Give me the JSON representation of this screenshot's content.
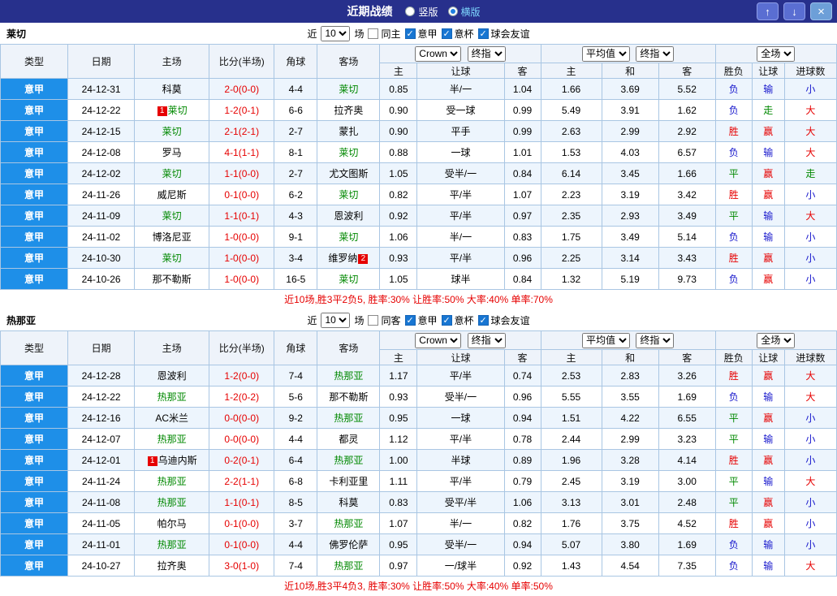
{
  "colors": {
    "navy": "#27308c",
    "accent": "#1e8fe8",
    "focus_green": "#008800",
    "score_red": "#e60000",
    "grid": "#a9c6e3"
  },
  "title_bar": {
    "title": "近期战绩",
    "vertical_label": "竖版",
    "horizontal_label": "横版",
    "up_icon": "↑",
    "down_icon": "↓",
    "close_icon": "×"
  },
  "filter": {
    "near_label": "近",
    "count_value": "10",
    "games_label": "场",
    "leagues": [
      "意甲",
      "意杯",
      "球会友谊"
    ]
  },
  "table_header": {
    "type": "类型",
    "date": "日期",
    "home": "主场",
    "score": "比分(半场)",
    "corner": "角球",
    "away": "客场",
    "handicap_group": {
      "book_select": "Crown",
      "stage_select": "终指",
      "home": "主",
      "line": "让球",
      "away": "客"
    },
    "europe_group": {
      "avg_select": "平均值",
      "stage_select": "终指",
      "home": "主",
      "draw": "和",
      "away": "客"
    },
    "result_group": {
      "scope_select": "全场",
      "wl": "胜负",
      "handicap": "让球",
      "goals": "进球数"
    }
  },
  "result_colors": {
    "胜": "red",
    "赢": "red",
    "大": "red",
    "平": "green",
    "走": "green",
    "负": "blue",
    "输": "blue",
    "小": "blue"
  },
  "sections": [
    {
      "team": "莱切",
      "same_label": "同主",
      "summary": "近10场,胜3平2负5, 胜率:30% 让胜率:50% 大率:40% 单率:70%",
      "rows": [
        {
          "league": "意甲",
          "date": "24-12-31",
          "home": "科莫",
          "score": "2-0(0-0)",
          "corner": "4-4",
          "away": "莱切",
          "away_focus": true,
          "ah_home": "0.85",
          "ah_line": "半/一",
          "ah_away": "1.04",
          "eu_home": "1.66",
          "eu_draw": "3.69",
          "eu_away": "5.52",
          "res_wl": "负",
          "res_ah": "输",
          "res_goal": "小"
        },
        {
          "league": "意甲",
          "date": "24-12-22",
          "home": "莱切",
          "home_badge": "1",
          "home_focus": true,
          "score": "1-2(0-1)",
          "corner": "6-6",
          "away": "拉齐奥",
          "ah_home": "0.90",
          "ah_line": "受一球",
          "ah_away": "0.99",
          "eu_home": "5.49",
          "eu_draw": "3.91",
          "eu_away": "1.62",
          "res_wl": "负",
          "res_ah": "走",
          "res_goal": "大"
        },
        {
          "league": "意甲",
          "date": "24-12-15",
          "home": "莱切",
          "home_focus": true,
          "score": "2-1(2-1)",
          "corner": "2-7",
          "away": "蒙扎",
          "ah_home": "0.90",
          "ah_line": "平手",
          "ah_away": "0.99",
          "eu_home": "2.63",
          "eu_draw": "2.99",
          "eu_away": "2.92",
          "res_wl": "胜",
          "res_ah": "赢",
          "res_goal": "大"
        },
        {
          "league": "意甲",
          "date": "24-12-08",
          "home": "罗马",
          "score": "4-1(1-1)",
          "corner": "8-1",
          "away": "莱切",
          "away_focus": true,
          "ah_home": "0.88",
          "ah_line": "一球",
          "ah_away": "1.01",
          "eu_home": "1.53",
          "eu_draw": "4.03",
          "eu_away": "6.57",
          "res_wl": "负",
          "res_ah": "输",
          "res_goal": "大"
        },
        {
          "league": "意甲",
          "date": "24-12-02",
          "home": "莱切",
          "home_focus": true,
          "score": "1-1(0-0)",
          "corner": "2-7",
          "away": "尤文图斯",
          "ah_home": "1.05",
          "ah_line": "受半/一",
          "ah_away": "0.84",
          "eu_home": "6.14",
          "eu_draw": "3.45",
          "eu_away": "1.66",
          "res_wl": "平",
          "res_ah": "赢",
          "res_goal": "走"
        },
        {
          "league": "意甲",
          "date": "24-11-26",
          "home": "威尼斯",
          "score": "0-1(0-0)",
          "corner": "6-2",
          "away": "莱切",
          "away_focus": true,
          "ah_home": "0.82",
          "ah_line": "平/半",
          "ah_away": "1.07",
          "eu_home": "2.23",
          "eu_draw": "3.19",
          "eu_away": "3.42",
          "res_wl": "胜",
          "res_ah": "赢",
          "res_goal": "小"
        },
        {
          "league": "意甲",
          "date": "24-11-09",
          "home": "莱切",
          "home_focus": true,
          "score": "1-1(0-1)",
          "corner": "4-3",
          "away": "恩波利",
          "ah_home": "0.92",
          "ah_line": "平/半",
          "ah_away": "0.97",
          "eu_home": "2.35",
          "eu_draw": "2.93",
          "eu_away": "3.49",
          "res_wl": "平",
          "res_ah": "输",
          "res_goal": "大"
        },
        {
          "league": "意甲",
          "date": "24-11-02",
          "home": "博洛尼亚",
          "score": "1-0(0-0)",
          "corner": "9-1",
          "away": "莱切",
          "away_focus": true,
          "ah_home": "1.06",
          "ah_line": "半/一",
          "ah_away": "0.83",
          "eu_home": "1.75",
          "eu_draw": "3.49",
          "eu_away": "5.14",
          "res_wl": "负",
          "res_ah": "输",
          "res_goal": "小"
        },
        {
          "league": "意甲",
          "date": "24-10-30",
          "home": "莱切",
          "home_focus": true,
          "score": "1-0(0-0)",
          "corner": "3-4",
          "away": "维罗纳",
          "away_badge": "2",
          "ah_home": "0.93",
          "ah_line": "平/半",
          "ah_away": "0.96",
          "eu_home": "2.25",
          "eu_draw": "3.14",
          "eu_away": "3.43",
          "res_wl": "胜",
          "res_ah": "赢",
          "res_goal": "小"
        },
        {
          "league": "意甲",
          "date": "24-10-26",
          "home": "那不勒斯",
          "score": "1-0(0-0)",
          "corner": "16-5",
          "away": "莱切",
          "away_focus": true,
          "ah_home": "1.05",
          "ah_line": "球半",
          "ah_away": "0.84",
          "eu_home": "1.32",
          "eu_draw": "5.19",
          "eu_away": "9.73",
          "res_wl": "负",
          "res_ah": "赢",
          "res_goal": "小"
        }
      ]
    },
    {
      "team": "热那亚",
      "same_label": "同客",
      "summary": "近10场,胜3平4负3, 胜率:30% 让胜率:50% 大率:40% 单率:50%",
      "rows": [
        {
          "league": "意甲",
          "date": "24-12-28",
          "home": "恩波利",
          "score": "1-2(0-0)",
          "corner": "7-4",
          "away": "热那亚",
          "away_focus": true,
          "ah_home": "1.17",
          "ah_line": "平/半",
          "ah_away": "0.74",
          "eu_home": "2.53",
          "eu_draw": "2.83",
          "eu_away": "3.26",
          "res_wl": "胜",
          "res_ah": "赢",
          "res_goal": "大"
        },
        {
          "league": "意甲",
          "date": "24-12-22",
          "home": "热那亚",
          "home_focus": true,
          "score": "1-2(0-2)",
          "corner": "5-6",
          "away": "那不勒斯",
          "ah_home": "0.93",
          "ah_line": "受半/一",
          "ah_away": "0.96",
          "eu_home": "5.55",
          "eu_draw": "3.55",
          "eu_away": "1.69",
          "res_wl": "负",
          "res_ah": "输",
          "res_goal": "大"
        },
        {
          "league": "意甲",
          "date": "24-12-16",
          "home": "AC米兰",
          "score": "0-0(0-0)",
          "corner": "9-2",
          "away": "热那亚",
          "away_focus": true,
          "ah_home": "0.95",
          "ah_line": "一球",
          "ah_away": "0.94",
          "eu_home": "1.51",
          "eu_draw": "4.22",
          "eu_away": "6.55",
          "res_wl": "平",
          "res_ah": "赢",
          "res_goal": "小"
        },
        {
          "league": "意甲",
          "date": "24-12-07",
          "home": "热那亚",
          "home_focus": true,
          "score": "0-0(0-0)",
          "corner": "4-4",
          "away": "都灵",
          "ah_home": "1.12",
          "ah_line": "平/半",
          "ah_away": "0.78",
          "eu_home": "2.44",
          "eu_draw": "2.99",
          "eu_away": "3.23",
          "res_wl": "平",
          "res_ah": "输",
          "res_goal": "小"
        },
        {
          "league": "意甲",
          "date": "24-12-01",
          "home": "乌迪内斯",
          "home_badge": "1",
          "score": "0-2(0-1)",
          "corner": "6-4",
          "away": "热那亚",
          "away_focus": true,
          "ah_home": "1.00",
          "ah_line": "半球",
          "ah_away": "0.89",
          "eu_home": "1.96",
          "eu_draw": "3.28",
          "eu_away": "4.14",
          "res_wl": "胜",
          "res_ah": "赢",
          "res_goal": "小"
        },
        {
          "league": "意甲",
          "date": "24-11-24",
          "home": "热那亚",
          "home_focus": true,
          "score": "2-2(1-1)",
          "corner": "6-8",
          "away": "卡利亚里",
          "ah_home": "1.11",
          "ah_line": "平/半",
          "ah_away": "0.79",
          "eu_home": "2.45",
          "eu_draw": "3.19",
          "eu_away": "3.00",
          "res_wl": "平",
          "res_ah": "输",
          "res_goal": "大"
        },
        {
          "league": "意甲",
          "date": "24-11-08",
          "home": "热那亚",
          "home_focus": true,
          "score": "1-1(0-1)",
          "corner": "8-5",
          "away": "科莫",
          "ah_home": "0.83",
          "ah_line": "受平/半",
          "ah_away": "1.06",
          "eu_home": "3.13",
          "eu_draw": "3.01",
          "eu_away": "2.48",
          "res_wl": "平",
          "res_ah": "赢",
          "res_goal": "小"
        },
        {
          "league": "意甲",
          "date": "24-11-05",
          "home": "帕尔马",
          "score": "0-1(0-0)",
          "corner": "3-7",
          "away": "热那亚",
          "away_focus": true,
          "ah_home": "1.07",
          "ah_line": "半/一",
          "ah_away": "0.82",
          "eu_home": "1.76",
          "eu_draw": "3.75",
          "eu_away": "4.52",
          "res_wl": "胜",
          "res_ah": "赢",
          "res_goal": "小"
        },
        {
          "league": "意甲",
          "date": "24-11-01",
          "home": "热那亚",
          "home_focus": true,
          "score": "0-1(0-0)",
          "corner": "4-4",
          "away": "佛罗伦萨",
          "ah_home": "0.95",
          "ah_line": "受半/一",
          "ah_away": "0.94",
          "eu_home": "5.07",
          "eu_draw": "3.80",
          "eu_away": "1.69",
          "res_wl": "负",
          "res_ah": "输",
          "res_goal": "小"
        },
        {
          "league": "意甲",
          "date": "24-10-27",
          "home": "拉齐奥",
          "score": "3-0(1-0)",
          "corner": "7-4",
          "away": "热那亚",
          "away_focus": true,
          "ah_home": "0.97",
          "ah_line": "一/球半",
          "ah_away": "0.92",
          "eu_home": "1.43",
          "eu_draw": "4.54",
          "eu_away": "7.35",
          "res_wl": "负",
          "res_ah": "输",
          "res_goal": "大"
        }
      ]
    }
  ]
}
